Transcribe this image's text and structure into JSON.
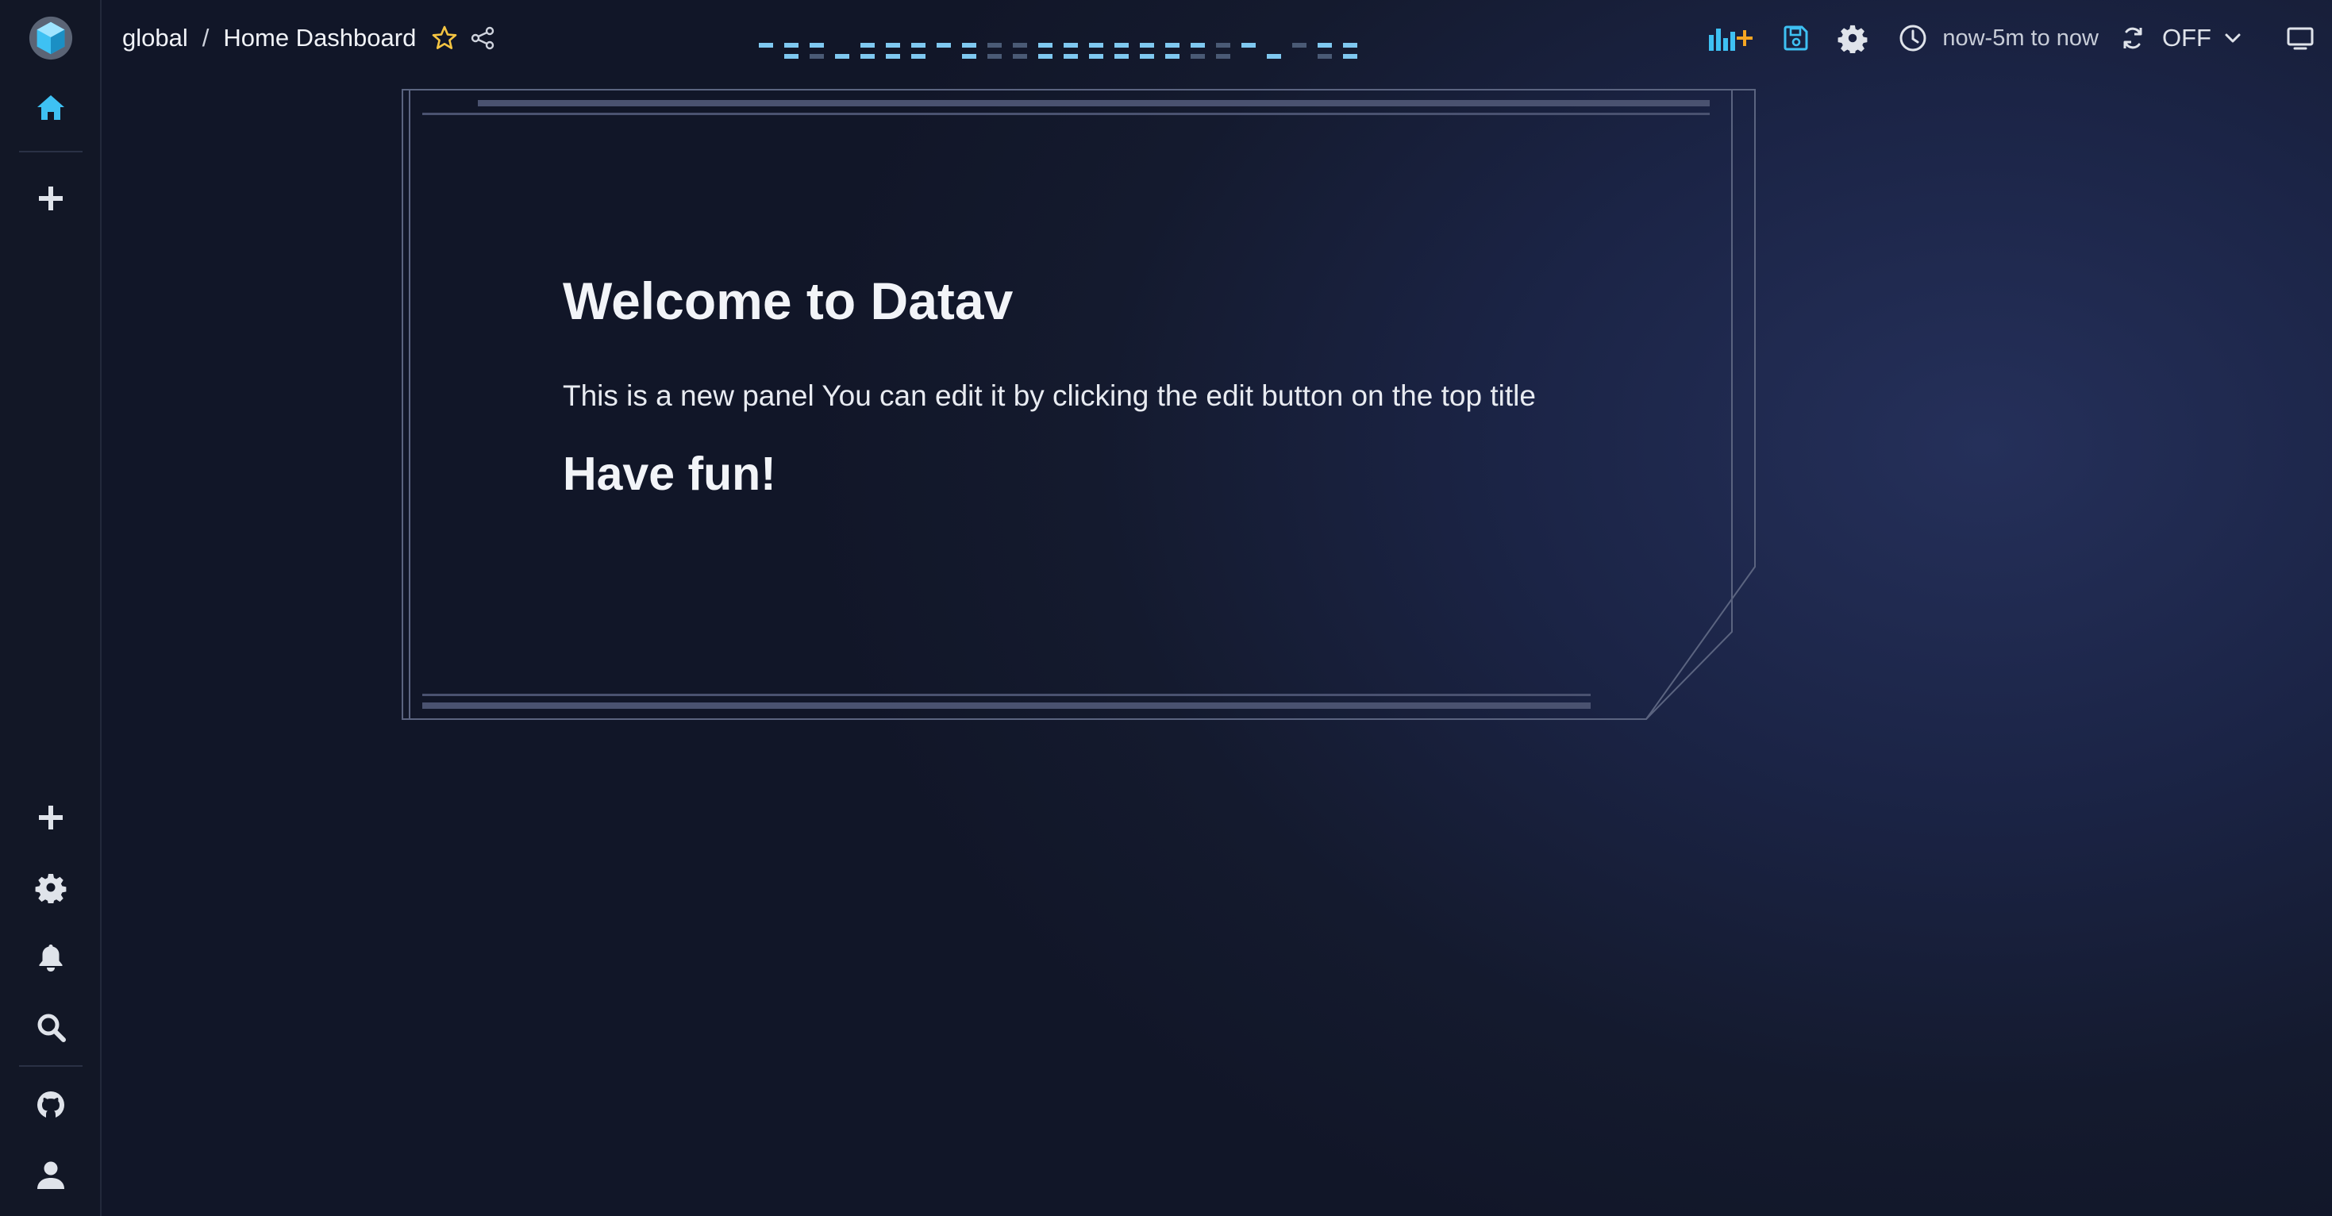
{
  "breadcrumb": {
    "team": "global",
    "separator": "/",
    "dashboard": "Home Dashboard"
  },
  "toolbar": {
    "time_range": "now-5m to now",
    "refresh": "OFF"
  },
  "panel": {
    "title": "Welcome to Datav",
    "text": "This is a new panel You can edit it by clicking the edit button on the top title",
    "footer": "Have fun!"
  },
  "icons": {
    "sidebar_top": [
      "logo-icon",
      "home-icon",
      "plus-icon"
    ],
    "sidebar_bottom": [
      "plus-icon",
      "gear-icon",
      "bell-icon",
      "search-icon",
      "github-icon",
      "user-icon"
    ],
    "toolbar": [
      "add-panel-icon",
      "save-icon",
      "gear-icon",
      "clock-icon",
      "refresh-icon",
      "chevron-down-icon",
      "monitor-icon"
    ]
  },
  "colors": {
    "accent": "#3ec1f3",
    "orange": "#f5a623",
    "background": "#111628",
    "sidebar": "#121726"
  }
}
